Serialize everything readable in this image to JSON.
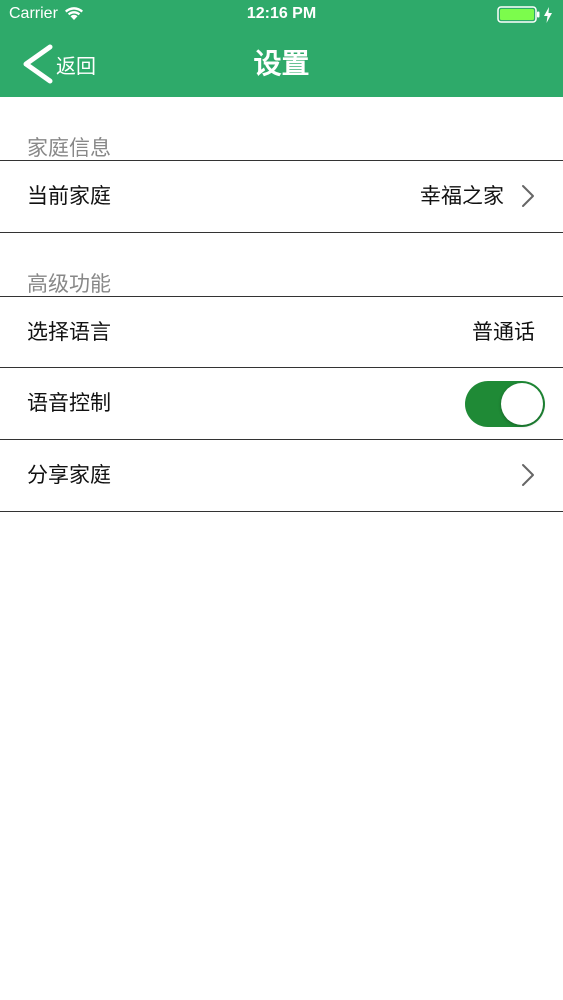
{
  "status_bar": {
    "carrier": "Carrier",
    "time": "12:16 PM",
    "icons": [
      "wifi-icon",
      "battery-icon",
      "charging-bolt-icon"
    ]
  },
  "nav": {
    "back_label": "返回",
    "title": "设置",
    "back_icon": "chevron-left-icon"
  },
  "sections": [
    {
      "header": "家庭信息",
      "rows": [
        {
          "label": "当前家庭",
          "value": "幸福之家",
          "accessory": "chevron-right-icon"
        }
      ]
    },
    {
      "header": "高级功能",
      "rows": [
        {
          "label": "选择语言",
          "value": "普通话"
        },
        {
          "label": "语音控制",
          "toggle_on": true,
          "accessory": "toggle-switch"
        },
        {
          "label": "分享家庭",
          "accessory": "chevron-right-icon"
        }
      ]
    }
  ],
  "colors": {
    "header_bg": "#2eaa6a",
    "toggle_on": "#1f8a36",
    "section_header_text": "#888888",
    "divider": "#333333"
  }
}
